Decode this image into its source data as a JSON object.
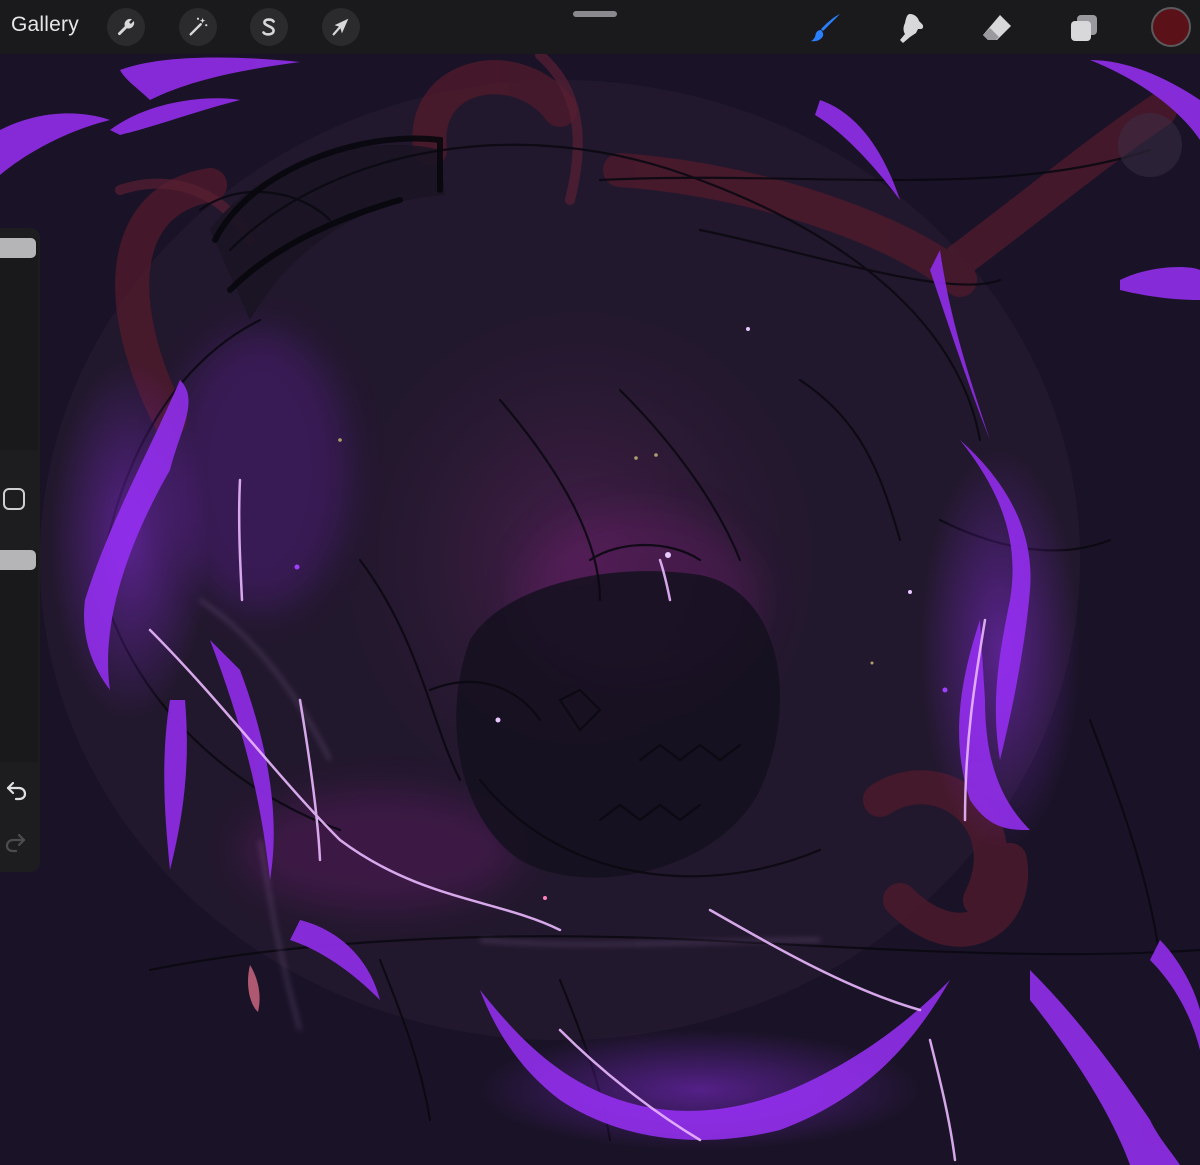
{
  "toolbar": {
    "gallery_label": "Gallery",
    "left_tools": [
      {
        "name": "actions",
        "icon": "wrench-icon"
      },
      {
        "name": "adjustments",
        "icon": "magic-wand-icon"
      },
      {
        "name": "selection",
        "icon": "selection-s-icon"
      },
      {
        "name": "transform",
        "icon": "arrow-cursor-icon"
      }
    ],
    "right_tools": [
      {
        "name": "brush",
        "icon": "brush-icon",
        "active": true
      },
      {
        "name": "smudge",
        "icon": "smudge-finger-icon",
        "active": false
      },
      {
        "name": "eraser",
        "icon": "eraser-icon",
        "active": false
      },
      {
        "name": "layers",
        "icon": "layers-icon",
        "active": false
      }
    ],
    "current_color": "#5a1218",
    "accent_color": "#2a7fff"
  },
  "sidebar": {
    "brush_size_level": 0.0,
    "brush_opacity_level": 0.0,
    "modify_icon": "square-modify-icon",
    "undo_icon": "undo-icon",
    "redo_icon": "redo-icon"
  },
  "canvas": {
    "artwork": "dark-purple-character-sketch",
    "palette": {
      "background": "#191327",
      "glow": "#8b2ce0",
      "highlight": "#e6b8ff",
      "red_lines": "#5a1a2a",
      "sketch_lines": "#0a0810"
    }
  }
}
